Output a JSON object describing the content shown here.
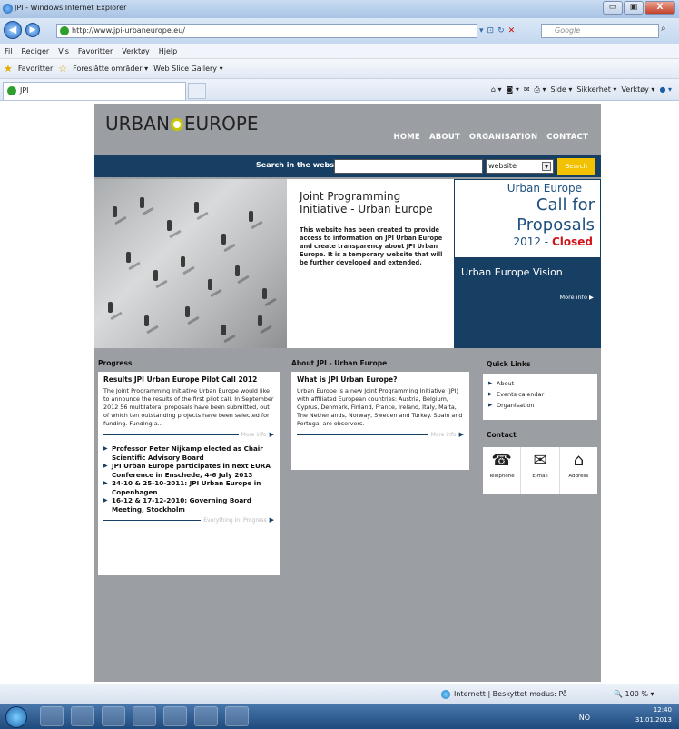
{
  "window": {
    "title": "JPI - Windows Internet Explorer",
    "min": "▭",
    "max": "▣",
    "close": "X"
  },
  "address": {
    "url": "http://www.jpi-urbaneurope.eu/",
    "search_placeholder": "Google"
  },
  "menu": [
    "Fil",
    "Rediger",
    "Vis",
    "Favoritter",
    "Verktøy",
    "Hjelp"
  ],
  "favorites": {
    "label": "Favoritter",
    "items": [
      "Foreslåtte områder ▾",
      "Web Slice Gallery ▾"
    ]
  },
  "tab": {
    "label": "JPI"
  },
  "commands": [
    "Side ▾",
    "Sikkerhet ▾",
    "Verktøy ▾"
  ],
  "site": {
    "logo_left": "URBAN",
    "logo_right": "EUROPE",
    "nav": [
      "HOME",
      "ABOUT",
      "ORGANISATION",
      "CONTACT"
    ],
    "search": {
      "label": "Search in the website:",
      "scope": "website",
      "button": "Search"
    },
    "hero": {
      "title": "Joint Programming Initiative - Urban Europe",
      "body": "This website has been created to provide access to information on JPI Urban Europe and create transparency about JPI Urban Europe. It is a temporary website that will be further developed and extended."
    },
    "call": {
      "line1": "Urban Europe",
      "line2": "Call for Proposals",
      "year": "2012",
      "status": "Closed"
    },
    "vision": {
      "title": "Urban Europe Vision",
      "more": "More info"
    },
    "progress": {
      "heading": "Progress",
      "box_title": "Results JPI Urban Europe Pilot Call 2012",
      "body": "The Joint Programming Initiative Urban Europe would like to announce the results of the first pilot call. In September 2012 56 multilateral proposals have been submitted, out of which ten outstanding projects have been selected for funding. Funding a...",
      "more": "More info",
      "news": [
        "Professor Peter Nijkamp elected as Chair Scientific Advisory Board",
        "JPI Urban Europe participates in next EURA Conference in Enschede, 4-6 July 2013",
        "24-10 & 25-10-2011: JPI Urban Europe in Copenhagen",
        "16-12 & 17-12-2010: Governing Board Meeting, Stockholm"
      ],
      "all": "Everything in: Progress"
    },
    "about": {
      "heading": "About JPI - Urban Europe",
      "box_title": "What is JPI Urban Europe?",
      "body": "Urban Europe is a new Joint Programming Initiative (JPI) with affiliated European countries: Austria, Belgium, Cyprus, Denmark, Finland, France, Ireland, Italy, Malta, The Netherlands, Norway, Sweden and Turkey. Spain and Portugal are observers.",
      "more": "More info"
    },
    "quick": {
      "heading": "Quick Links",
      "items": [
        "About",
        "Events calendar",
        "Organisation"
      ]
    },
    "contact": {
      "heading": "Contact",
      "items": [
        "Telephone",
        "E-mail",
        "Address"
      ]
    }
  },
  "status": {
    "zone": "Internett | Beskyttet modus: På",
    "zoom": "100 %"
  },
  "taskbar": {
    "lang": "NO",
    "time": "12:40",
    "date": "31.01.2013"
  }
}
